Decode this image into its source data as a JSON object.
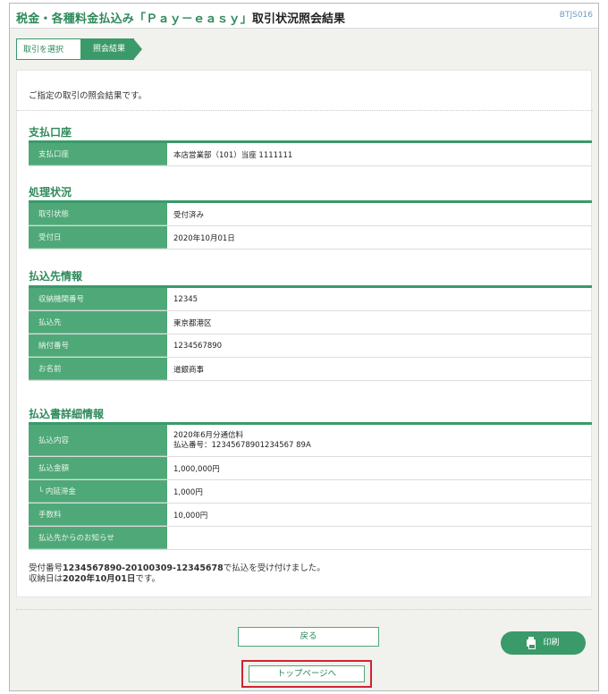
{
  "header": {
    "app_title": "税金・各種料金払込み「Ｐａｙ－ｅａｓｙ」",
    "page_title": "取引状況照会結果",
    "screen_id": "BTJS016"
  },
  "steps": [
    "取引を選択",
    "照会結果"
  ],
  "intro": "ご指定の取引の照会結果です。",
  "sections": [
    {
      "title": "支払口座",
      "rows": [
        {
          "label": "支払口座",
          "value": "本店営業部（101）当座 1111111"
        }
      ]
    },
    {
      "title": "処理状況",
      "rows": [
        {
          "label": "取引状態",
          "value": "受付済み"
        },
        {
          "label": "受付日",
          "value": "2020年10月01日"
        }
      ]
    },
    {
      "title": "払込先情報",
      "rows": [
        {
          "label": "収納機関番号",
          "value": "12345"
        },
        {
          "label": "払込先",
          "value": "東京都港区"
        },
        {
          "label": "納付番号",
          "value": "1234567890"
        },
        {
          "label": "お名前",
          "value": "道銀商事"
        }
      ]
    },
    {
      "title": "払込書詳細情報",
      "rows": [
        {
          "label": "払込内容",
          "value_line1": "2020年6月分通信料",
          "value_line2": "払込番号：12345678901234567 89A"
        },
        {
          "label": "払込金額",
          "value": "1,000,000円"
        },
        {
          "label": "└ 内延滞金",
          "value": "1,000円"
        },
        {
          "label": "手数料",
          "value": "10,000円"
        },
        {
          "label": "払込先からのお知らせ",
          "value": ""
        }
      ]
    }
  ],
  "note": {
    "prefix": "受付番号",
    "receipt_no": "1234567890-20100309-12345678",
    "suffix": "で払込を受け付けました。",
    "date_prefix": "収納日は",
    "date": "2020年10月01日",
    "date_suffix": "です。"
  },
  "buttons": {
    "back": "戻る",
    "print": "印刷",
    "top": "トップページへ"
  }
}
